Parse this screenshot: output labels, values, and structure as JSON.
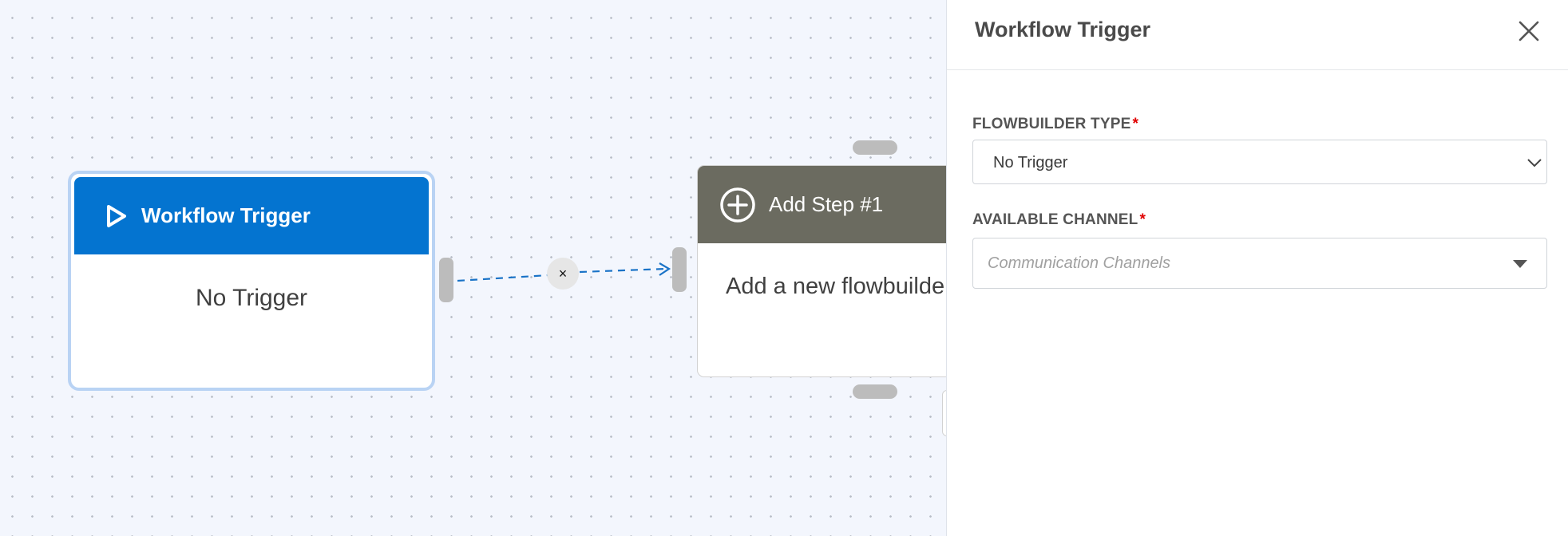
{
  "canvas": {
    "trigger_node": {
      "title": "Workflow Trigger",
      "body": "No Trigger"
    },
    "edge": {
      "delete_symbol": "×",
      "color": "#1a73c7"
    },
    "step_node": {
      "title": "Add Step #1",
      "body": "Add a new flowbuilder"
    }
  },
  "panel": {
    "title": "Workflow Trigger",
    "close_symbol": "close-icon",
    "fields": {
      "flowbuilder_type": {
        "label": "FLOWBUILDER TYPE",
        "required": "*",
        "value": "No Trigger"
      },
      "available_channel": {
        "label": "AVAILABLE CHANNEL",
        "required": "*",
        "placeholder": "Communication Channels"
      }
    }
  },
  "colors": {
    "trigger_header": "#0474d0",
    "step_header": "#6b6b60",
    "required": "#e00000"
  }
}
